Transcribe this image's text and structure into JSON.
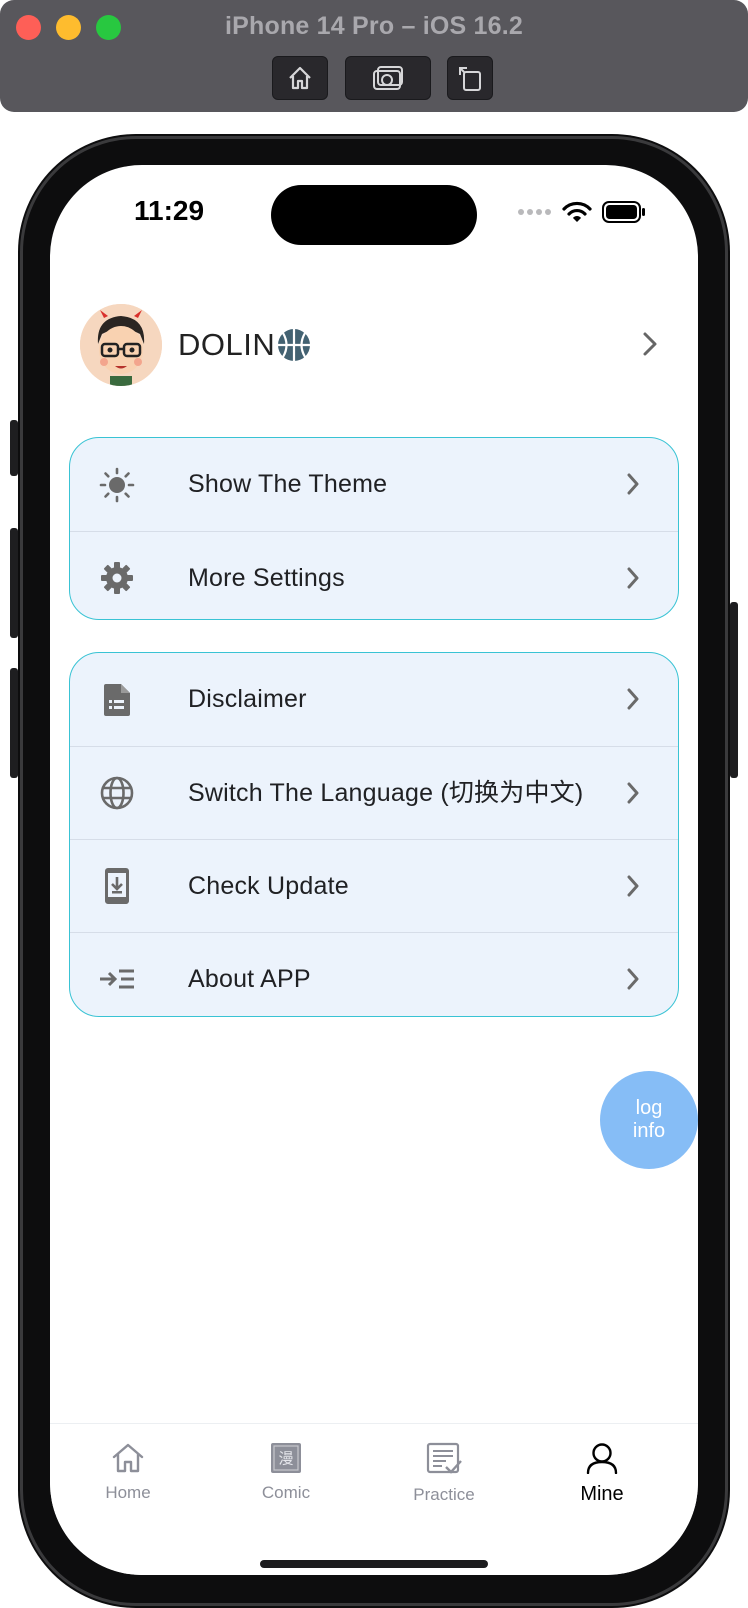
{
  "simulator": {
    "title": "iPhone 14 Pro – iOS 16.2",
    "buttons": [
      "home-icon",
      "screenshot-icon",
      "rotate-icon"
    ]
  },
  "status_bar": {
    "time": "11:29",
    "icons": [
      "cellular-dots-icon",
      "wifi-icon",
      "battery-icon"
    ]
  },
  "profile": {
    "name": "DOLIN",
    "badge_icon": "basketball-icon"
  },
  "settings_group_1": [
    {
      "icon": "sun-icon",
      "label": "Show The Theme"
    },
    {
      "icon": "gear-icon",
      "label": "More Settings"
    }
  ],
  "settings_group_2": [
    {
      "icon": "document-icon",
      "label": "Disclaimer"
    },
    {
      "icon": "globe-icon",
      "label": "Switch The Language (切换为中文)"
    },
    {
      "icon": "phone-download-icon",
      "label": "Check Update"
    },
    {
      "icon": "indent-icon",
      "label": "About APP"
    }
  ],
  "fab": {
    "line1": "log",
    "line2": "info"
  },
  "tabs": [
    {
      "icon": "home-icon",
      "label": "Home",
      "active": false
    },
    {
      "icon": "comic-icon",
      "label": "Comic",
      "glyph": "漫",
      "active": false
    },
    {
      "icon": "practice-icon",
      "label": "Practice",
      "active": false
    },
    {
      "icon": "person-icon",
      "label": "Mine",
      "active": true
    }
  ],
  "colors": {
    "card_bg": "#ecf3fc",
    "card_border": "#39c3d4",
    "fab": "#86bdf6",
    "tab_inactive": "#8d8f99",
    "tab_active": "#000000"
  }
}
